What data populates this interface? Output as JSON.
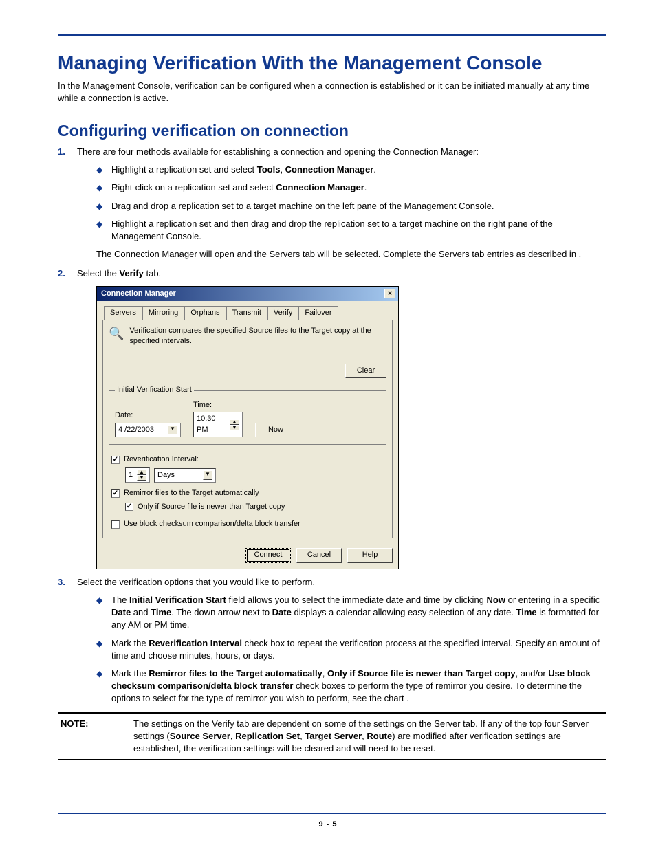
{
  "headings": {
    "h1": "Managing Verification With the Management Console",
    "h2": "Configuring verification on connection"
  },
  "intro": "In the Management Console, verification can be configured when a connection is established or it can be initiated manually at any time while a connection is active.",
  "step1": {
    "num": "1.",
    "lead": "There are four methods available for establishing a connection and opening the Connection Manager:",
    "bullets": {
      "b1_pre": "Highlight a replication set and select ",
      "b1_bold1": "Tools",
      "b1_mid": ", ",
      "b1_bold2": "Connection Manager",
      "b1_post": ".",
      "b2_pre": "Right-click on a replication set and select ",
      "b2_bold": "Connection Manager",
      "b2_post": ".",
      "b3": "Drag and drop a replication set to a target machine on the left pane of the Management Console.",
      "b4": "Highlight a replication set and then drag and drop the replication set to a target machine on the right pane of the Management Console."
    },
    "tail": "The Connection Manager will open and the Servers tab will be selected.  Complete the Servers tab entries as described in ."
  },
  "step2": {
    "num": "2.",
    "pre": "Select the ",
    "bold": "Verify",
    "post": " tab."
  },
  "dialog": {
    "title": "Connection Manager",
    "close": "×",
    "tabs": [
      "Servers",
      "Mirroring",
      "Orphans",
      "Transmit",
      "Verify",
      "Failover"
    ],
    "active_tab_index": 4,
    "desc": "Verification compares the specified Source files to the Target copy at the specified intervals.",
    "clear": "Clear",
    "ivs": {
      "legend": "Initial Verification Start",
      "date_label": "Date:",
      "date_value": "4 /22/2003",
      "time_label": "Time:",
      "time_value": "10:30 PM",
      "now": "Now"
    },
    "reverify_label": "Reverification Interval:",
    "reverify_value": "1",
    "reverify_unit": "Days",
    "remirror_label": "Remirror files to the Target automatically",
    "onlyif_label": "Only if Source file is newer than Target copy",
    "checksum_label": "Use block checksum comparison/delta block transfer",
    "connect": "Connect",
    "cancel": "Cancel",
    "help": "Help"
  },
  "step3": {
    "num": "3.",
    "lead": "Select the verification options that you would like to perform.",
    "bullets": {
      "b1": {
        "p1": "The ",
        "bold1": "Initial Verification Start",
        "p2": " field allows you to select the immediate date and time by clicking ",
        "bold2": "Now",
        "p3": " or entering in a specific ",
        "bold3": "Date",
        "p4": " and ",
        "bold4": "Time",
        "p5": ". The down arrow next to ",
        "bold5": "Date",
        "p6": " displays a calendar allowing easy selection of any date. ",
        "bold6": "Time",
        "p7": " is formatted for any AM or PM time."
      },
      "b2": {
        "p1": "Mark the ",
        "bold1": "Reverification Interval",
        "p2": " check box to repeat the verification process at the specified interval. Specify an amount of time and choose minutes, hours, or days."
      },
      "b3": {
        "p1": "Mark the ",
        "bold1": "Remirror files to the Target automatically",
        "p2": ", ",
        "bold2": "Only if Source file is newer than Target copy",
        "p3": ", and/or ",
        "bold3": "Use block checksum comparison/delta block transfer",
        "p4": " check boxes to perform the type of remirror you desire. To determine the options to select for the type of remirror you wish to perform, see the chart ."
      }
    }
  },
  "note": {
    "label": "NOTE:",
    "p1": "The settings on the Verify tab are dependent on some of the settings on the Server tab. If any of the top four Server settings (",
    "b1": "Source Server",
    "c1": ", ",
    "b2": "Replication Set",
    "c2": ", ",
    "b3": "Target Server",
    "c3": ", ",
    "b4": "Route",
    "p2": ") are modified after verification settings are established, the verification settings will be cleared and will need to be reset."
  },
  "footer": "9 - 5"
}
